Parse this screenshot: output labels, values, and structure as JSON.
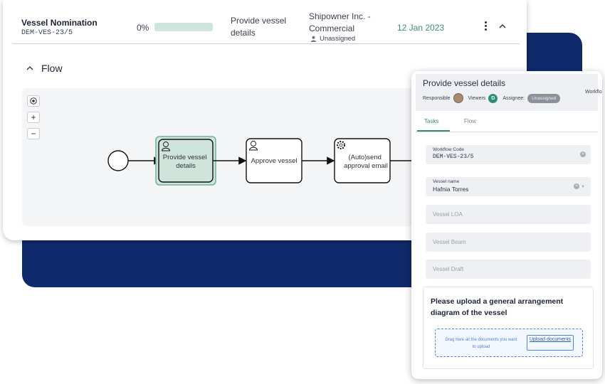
{
  "row": {
    "title": "Vessel Nomination",
    "code": "DEM-VES-23/5",
    "progress_label": "0%",
    "progress_value": 0,
    "step": "Provide vessel details",
    "company": "Shipowner Inc. - Commercial",
    "assignee": "Unassigned",
    "date": "12 Jan 2023"
  },
  "flow": {
    "title": "Flow",
    "zoom": {
      "plus": "+",
      "minus": "−"
    },
    "nodes": {
      "provide": "Provide vessel details",
      "approve": "Approve vessel",
      "auto": "(Auto)send approval email"
    }
  },
  "panel": {
    "title": "Provide vessel details",
    "responsible_label": "Responsible",
    "viewers_label": "Viewers",
    "viewer_initial": "D",
    "assignee_label": "Assignee:",
    "assignee_value": "Unassigned",
    "workflow_cut": "Workflo",
    "tabs": [
      "Tasks",
      "Flow"
    ],
    "fields": {
      "workflow_code": {
        "label": "Workflow Code",
        "value": "DEM-VES-23/5"
      },
      "vessel_name": {
        "label": "Vessel name",
        "value": "Hafnia Torres"
      },
      "vessel_loa": {
        "placeholder": "Vessel LOA"
      },
      "vessel_beam": {
        "placeholder": "Vessel Beam"
      },
      "vessel_draft": {
        "placeholder": "Vessel Draft"
      }
    },
    "upload": {
      "title": "Please upload a general arrangement diagram of the vessel",
      "drop_text": "Drag here all the documents you want to upload",
      "button": "Upload documents"
    }
  },
  "colors": {
    "navy": "#0f2a6b",
    "accent_green": "#3f8f6f",
    "active_task_fill": "#cfe5dc",
    "link_blue": "#4f84d8"
  }
}
